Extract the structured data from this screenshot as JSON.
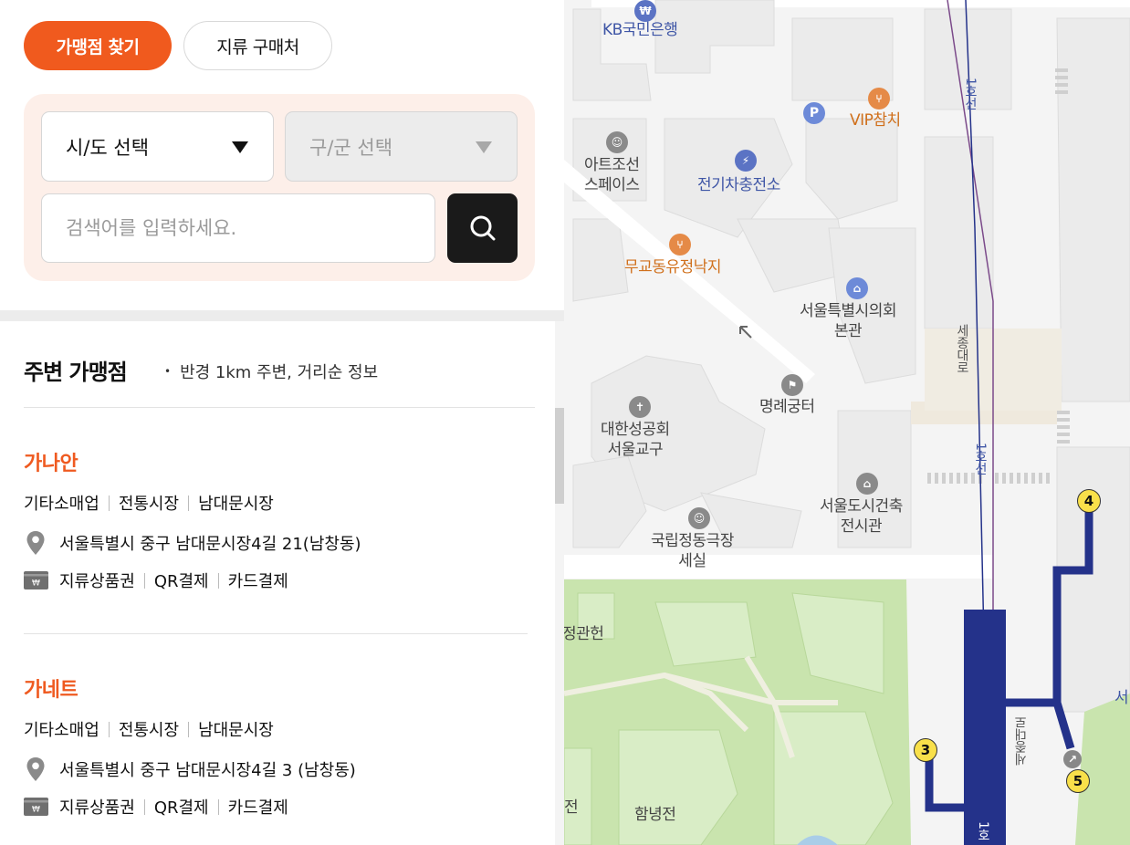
{
  "tabs": {
    "franchise": "가맹점 찾기",
    "paper": "지류 구매처"
  },
  "search": {
    "sido_placeholder": "시/도 선택",
    "gugun_placeholder": "구/군 선택",
    "keyword_placeholder": "검색어를 입력하세요."
  },
  "nearby": {
    "title": "주변 가맹점",
    "subtitle": "반경 1km 주변, 거리순 정보"
  },
  "stores": [
    {
      "name": "가나안",
      "categories": [
        "기타소매업",
        "전통시장",
        "남대문시장"
      ],
      "address": "서울특별시 중구 남대문시장4길 21(남창동)",
      "payments": [
        "지류상품권",
        "QR결제",
        "카드결제"
      ]
    },
    {
      "name": "가네트",
      "categories": [
        "기타소매업",
        "전통시장",
        "남대문시장"
      ],
      "address": "서울특별시 중구 남대문시장4길 3 (남창동)",
      "payments": [
        "지류상품권",
        "QR결제",
        "카드결제"
      ]
    }
  ],
  "map": {
    "labels": {
      "kb": "KB국민은행",
      "vip": "VIP참치",
      "art": "아트조선\n스페이스",
      "ev": "전기차충전소",
      "mugyo": "무교동유정낙지",
      "council": "서울특별시의회\n본관",
      "church": "대한성공회\n서울교구",
      "myeongrye": "명례궁터",
      "theater": "국립정동극장\n세실",
      "archive": "서울도시건축\n전시관",
      "sejong_road": "세종대로",
      "line1_top": "1호선",
      "line1_mid": "1호선",
      "line1_bottom": "1호",
      "sejong_road2": "세종대로",
      "jeonggwan": "정관헌",
      "jeon": "전",
      "hamnyeong": "함녕전",
      "seo": "서",
      "parking": "P"
    },
    "exits": [
      "4",
      "3",
      "5"
    ],
    "colors": {
      "line1": "#24328a",
      "park": "#c9e5b0",
      "building": "#e6e6e6",
      "accent": "#f05a1e"
    }
  }
}
